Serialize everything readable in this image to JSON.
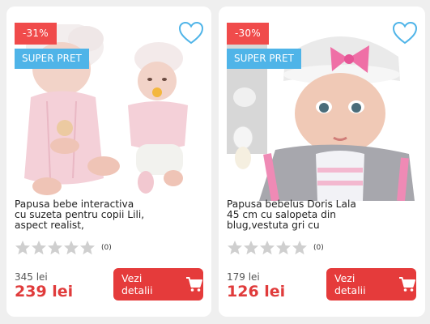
{
  "products": [
    {
      "discount": "-31%",
      "badge": "SUPER PRET",
      "title": "Papusa bebe interactiva cu suzeta pentru copii Lili, aspect realist,",
      "rating_stars": 0,
      "reviews": "(0)",
      "old_price": "345 lei",
      "new_price": "239 lei",
      "button_label": "Vezi detalii"
    },
    {
      "discount": "-30%",
      "badge": "SUPER PRET",
      "title": "Papusa bebelus Doris Lala 45 cm cu salopeta din blug,vestuta gri cu",
      "rating_stars": 0,
      "reviews": "(0)",
      "old_price": "179 lei",
      "new_price": "126 lei",
      "button_label": "Vezi detalii"
    }
  ],
  "icons": {
    "wishlist": "heart-outline-icon",
    "rating": "star-icon",
    "cart": "shopping-cart-icon"
  },
  "colors": {
    "discount_badge": "#f04b4b",
    "super_badge": "#4fb4e8",
    "price": "#e03b3b",
    "button": "#e53b3b",
    "heart": "#4fb4e8",
    "star_empty": "#cfcfcf"
  }
}
